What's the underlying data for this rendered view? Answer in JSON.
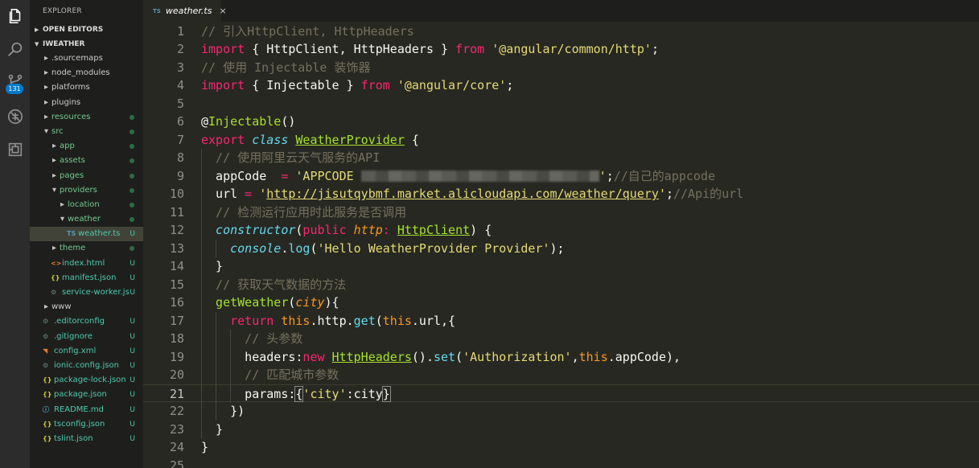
{
  "activity_bar": {
    "items": [
      {
        "icon": "files-icon"
      },
      {
        "icon": "search-icon"
      },
      {
        "icon": "source-control-icon",
        "badge": "131"
      },
      {
        "icon": "debug-icon"
      },
      {
        "icon": "extensions-icon"
      }
    ]
  },
  "sidebar": {
    "title": "EXPLORER",
    "open_editors": "OPEN EDITORS",
    "project": "IWEATHER",
    "tree": [
      {
        "label": ".sourcemaps",
        "depth": 0,
        "type": "folder",
        "open": false,
        "status": ""
      },
      {
        "label": "node_modules",
        "depth": 0,
        "type": "folder",
        "open": false,
        "status": ""
      },
      {
        "label": "platforms",
        "depth": 0,
        "type": "folder",
        "open": false,
        "status": ""
      },
      {
        "label": "plugins",
        "depth": 0,
        "type": "folder",
        "open": false,
        "status": ""
      },
      {
        "label": "resources",
        "depth": 0,
        "type": "folder",
        "open": false,
        "status": "dot"
      },
      {
        "label": "src",
        "depth": 0,
        "type": "folder",
        "open": true,
        "status": "dot"
      },
      {
        "label": "app",
        "depth": 1,
        "type": "folder",
        "open": false,
        "status": "dot"
      },
      {
        "label": "assets",
        "depth": 1,
        "type": "folder",
        "open": false,
        "status": "dot"
      },
      {
        "label": "pages",
        "depth": 1,
        "type": "folder",
        "open": false,
        "status": "dot"
      },
      {
        "label": "providers",
        "depth": 1,
        "type": "folder",
        "open": true,
        "status": "dot"
      },
      {
        "label": "location",
        "depth": 2,
        "type": "folder",
        "open": false,
        "status": "dot"
      },
      {
        "label": "weather",
        "depth": 2,
        "type": "folder",
        "open": true,
        "status": "dot"
      },
      {
        "label": "weather.ts",
        "depth": 3,
        "type": "ts",
        "status": "U",
        "selected": true
      },
      {
        "label": "theme",
        "depth": 1,
        "type": "folder",
        "open": false,
        "status": "dot"
      },
      {
        "label": "index.html",
        "depth": 1,
        "type": "html",
        "status": "U"
      },
      {
        "label": "manifest.json",
        "depth": 1,
        "type": "json",
        "status": "U"
      },
      {
        "label": "service-worker.js",
        "depth": 1,
        "type": "gear",
        "status": "U"
      },
      {
        "label": "www",
        "depth": 0,
        "type": "folder",
        "open": false,
        "status": ""
      },
      {
        "label": ".editorconfig",
        "depth": 0,
        "type": "gear",
        "status": "U"
      },
      {
        "label": ".gitignore",
        "depth": 0,
        "type": "gear",
        "status": "U"
      },
      {
        "label": "config.xml",
        "depth": 0,
        "type": "rss",
        "status": "U"
      },
      {
        "label": "ionic.config.json",
        "depth": 0,
        "type": "gear",
        "status": "U"
      },
      {
        "label": "package-lock.json",
        "depth": 0,
        "type": "json",
        "status": "U"
      },
      {
        "label": "package.json",
        "depth": 0,
        "type": "json",
        "status": "U"
      },
      {
        "label": "README.md",
        "depth": 0,
        "type": "info",
        "status": "U"
      },
      {
        "label": "tsconfig.json",
        "depth": 0,
        "type": "json",
        "status": "U"
      },
      {
        "label": "tslint.json",
        "depth": 0,
        "type": "json",
        "status": "U"
      }
    ]
  },
  "tabs": [
    {
      "prefix": "TS",
      "label": "weather.ts",
      "close": "×"
    }
  ],
  "editor": {
    "current_line": 21,
    "lines": [
      {
        "n": "1",
        "indent": 0,
        "tokens": [
          [
            "c-comment",
            "// 引入HttpClient, HttpHeaders"
          ]
        ]
      },
      {
        "n": "2",
        "indent": 0,
        "tokens": [
          [
            "c-kw",
            "import"
          ],
          [
            "c-plain",
            " { HttpClient, HttpHeaders } "
          ],
          [
            "c-kw",
            "from"
          ],
          [
            "c-plain",
            " "
          ],
          [
            "c-str",
            "'@angular/common/http'"
          ],
          [
            "c-plain",
            ";"
          ]
        ]
      },
      {
        "n": "3",
        "indent": 0,
        "tokens": [
          [
            "c-comment",
            "// 使用 Injectable 装饰器"
          ]
        ]
      },
      {
        "n": "4",
        "indent": 0,
        "tokens": [
          [
            "c-kw",
            "import"
          ],
          [
            "c-plain",
            " { Injectable } "
          ],
          [
            "c-kw",
            "from"
          ],
          [
            "c-plain",
            " "
          ],
          [
            "c-str",
            "'@angular/core'"
          ],
          [
            "c-plain",
            ";"
          ]
        ]
      },
      {
        "n": "5",
        "indent": 0,
        "tokens": []
      },
      {
        "n": "6",
        "indent": 0,
        "tokens": [
          [
            "c-plain",
            "@"
          ],
          [
            "c-fn",
            "Injectable"
          ],
          [
            "c-plain",
            "()"
          ]
        ]
      },
      {
        "n": "7",
        "indent": 0,
        "tokens": [
          [
            "c-kw",
            "export"
          ],
          [
            "c-plain",
            " "
          ],
          [
            "c-class-kw",
            "class"
          ],
          [
            "c-plain",
            " "
          ],
          [
            "c-cls",
            "WeatherProvider"
          ],
          [
            "c-plain",
            " {"
          ]
        ]
      },
      {
        "n": "8",
        "indent": 1,
        "tokens": [
          [
            "c-comment",
            "// 使用阿里云天气服务的API"
          ]
        ]
      },
      {
        "n": "9",
        "indent": 1,
        "tokens": [
          [
            "c-prop",
            "appCode"
          ],
          [
            "c-plain",
            "  "
          ],
          [
            "c-kw",
            "="
          ],
          [
            "c-plain",
            " "
          ],
          [
            "c-str",
            "'APPCODE "
          ],
          [
            "blur",
            ""
          ],
          [
            "c-str",
            "'"
          ],
          [
            "c-plain",
            ";"
          ],
          [
            "c-comment",
            "//自己的appcode"
          ]
        ]
      },
      {
        "n": "10",
        "indent": 1,
        "tokens": [
          [
            "c-prop",
            "url"
          ],
          [
            "c-plain",
            " "
          ],
          [
            "c-kw",
            "="
          ],
          [
            "c-plain",
            " "
          ],
          [
            "c-str",
            "'"
          ],
          [
            "c-url",
            "http://jisutqybmf.market.alicloudapi.com/weather/query"
          ],
          [
            "c-str",
            "'"
          ],
          [
            "c-plain",
            ";"
          ],
          [
            "c-comment",
            "//Api的url"
          ]
        ]
      },
      {
        "n": "11",
        "indent": 1,
        "tokens": [
          [
            "c-comment",
            "// 检测运行应用时此服务是否调用"
          ]
        ]
      },
      {
        "n": "12",
        "indent": 1,
        "tokens": [
          [
            "c-class-kw",
            "constructor"
          ],
          [
            "c-plain",
            "("
          ],
          [
            "c-kw",
            "public"
          ],
          [
            "c-plain",
            " "
          ],
          [
            "c-param",
            "http"
          ],
          [
            "c-kw",
            ":"
          ],
          [
            "c-plain",
            " "
          ],
          [
            "c-cls",
            "HttpClient"
          ],
          [
            "c-plain",
            ") {"
          ]
        ]
      },
      {
        "n": "13",
        "indent": 2,
        "tokens": [
          [
            "c-class-kw",
            "console"
          ],
          [
            "c-plain",
            "."
          ],
          [
            "c-method",
            "log"
          ],
          [
            "c-plain",
            "("
          ],
          [
            "c-str",
            "'Hello WeatherProvider Provider'"
          ],
          [
            "c-plain",
            ");"
          ]
        ]
      },
      {
        "n": "14",
        "indent": 1,
        "tokens": [
          [
            "c-plain",
            "}"
          ]
        ]
      },
      {
        "n": "15",
        "indent": 1,
        "tokens": [
          [
            "c-comment",
            "// 获取天气数据的方法"
          ]
        ]
      },
      {
        "n": "16",
        "indent": 1,
        "tokens": [
          [
            "c-fn",
            "getWeather"
          ],
          [
            "c-plain",
            "("
          ],
          [
            "c-param",
            "city"
          ],
          [
            "c-plain",
            "){"
          ]
        ]
      },
      {
        "n": "17",
        "indent": 2,
        "tokens": [
          [
            "c-kw",
            "return"
          ],
          [
            "c-plain",
            " "
          ],
          [
            "c-this",
            "this"
          ],
          [
            "c-plain",
            ".http."
          ],
          [
            "c-method",
            "get"
          ],
          [
            "c-plain",
            "("
          ],
          [
            "c-this",
            "this"
          ],
          [
            "c-plain",
            ".url,{"
          ]
        ]
      },
      {
        "n": "18",
        "indent": 3,
        "tokens": [
          [
            "c-comment",
            "// 头参数"
          ]
        ]
      },
      {
        "n": "19",
        "indent": 3,
        "tokens": [
          [
            "c-prop",
            "headers"
          ],
          [
            "c-plain",
            ":"
          ],
          [
            "c-kw",
            "new"
          ],
          [
            "c-plain",
            " "
          ],
          [
            "c-cls",
            "HttpHeaders"
          ],
          [
            "c-plain",
            "()."
          ],
          [
            "c-method",
            "set"
          ],
          [
            "c-plain",
            "("
          ],
          [
            "c-str",
            "'Authorization'"
          ],
          [
            "c-plain",
            ","
          ],
          [
            "c-this",
            "this"
          ],
          [
            "c-plain",
            ".appCode),"
          ]
        ]
      },
      {
        "n": "20",
        "indent": 3,
        "tokens": [
          [
            "c-comment",
            "// 匹配城市参数"
          ]
        ]
      },
      {
        "n": "21",
        "indent": 3,
        "tokens": [
          [
            "c-prop",
            "params"
          ],
          [
            "c-plain",
            ":"
          ],
          [
            "bracket",
            "{"
          ],
          [
            "c-str",
            "'city'"
          ],
          [
            "c-plain",
            ":city"
          ],
          [
            "bracket",
            "}"
          ]
        ]
      },
      {
        "n": "22",
        "indent": 2,
        "tokens": [
          [
            "c-plain",
            "})"
          ]
        ]
      },
      {
        "n": "23",
        "indent": 1,
        "tokens": [
          [
            "c-plain",
            "}"
          ]
        ]
      },
      {
        "n": "24",
        "indent": 0,
        "tokens": [
          [
            "c-plain",
            "}"
          ]
        ]
      },
      {
        "n": "25",
        "indent": 0,
        "tokens": []
      }
    ]
  }
}
